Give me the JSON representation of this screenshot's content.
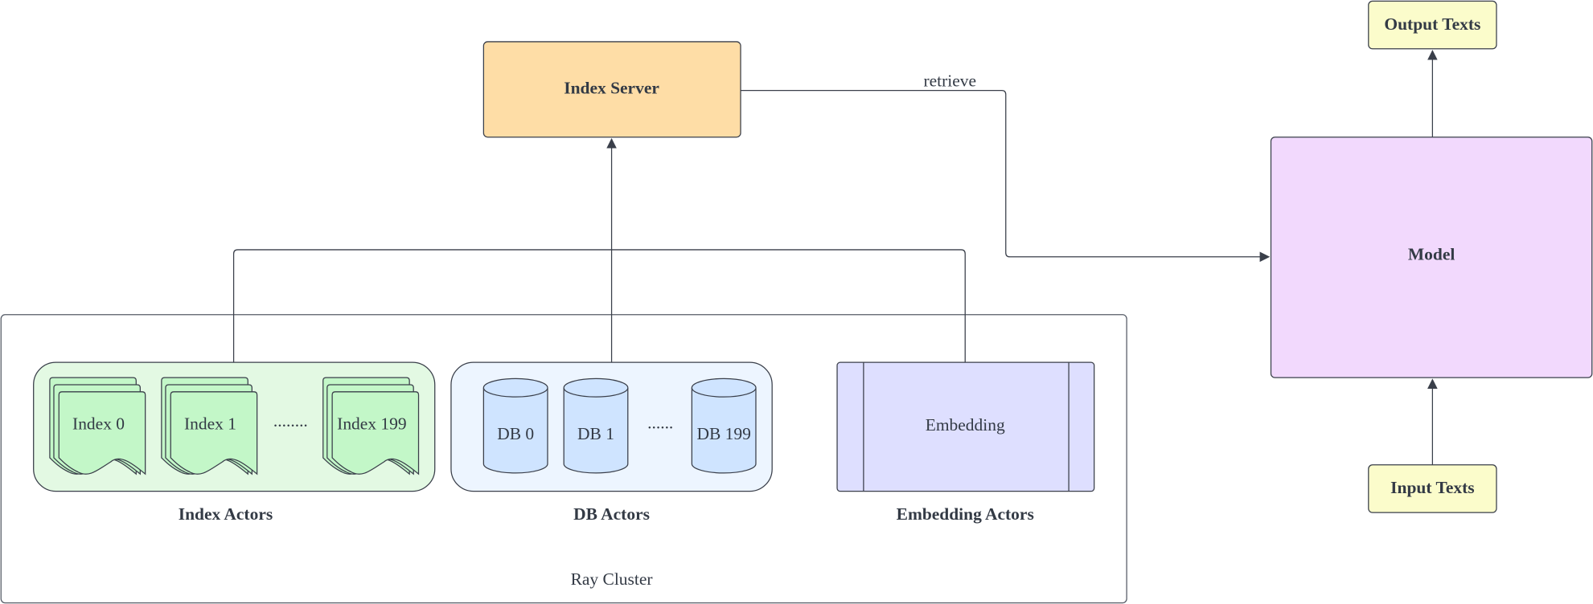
{
  "colors": {
    "index_server": "#fedda6",
    "index_actors_bg": "#e3f9e3",
    "index_doc": "#c3f7c8",
    "db_actors_bg": "#edf5ff",
    "db_cylinder": "#cfe4ff",
    "embedding": "#dedfff",
    "model": "#f2d9fd",
    "texts": "#fbfccb",
    "stroke": "#3a3f4a"
  },
  "index_server": {
    "label": "Index Server"
  },
  "edge_retrieve": {
    "label": "retrieve"
  },
  "ray_cluster": {
    "label": "Ray Cluster"
  },
  "index_actors": {
    "label": "Index Actors",
    "items": [
      "Index 0",
      "Index 1",
      "Index 199"
    ],
    "ellipsis": "........"
  },
  "db_actors": {
    "label": "DB Actors",
    "items": [
      "DB 0",
      "DB 1",
      "DB 199"
    ],
    "ellipsis": "......"
  },
  "embedding_actors": {
    "label": "Embedding Actors",
    "item": "Embedding"
  },
  "model": {
    "label": "Model"
  },
  "output_texts": {
    "label": "Output Texts"
  },
  "input_texts": {
    "label": "Input Texts"
  }
}
